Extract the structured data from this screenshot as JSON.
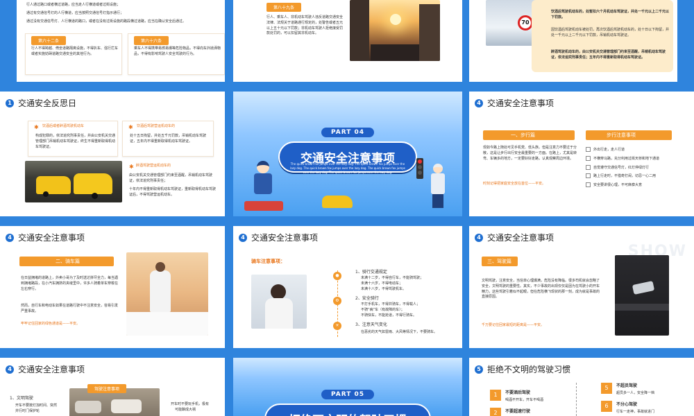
{
  "slides": {
    "s1": {
      "para1": "行人通过路口或者横过道路，应当走人行横道或者过街设施；",
      "para2": "通过有交通信号灯的人行横道，应当按照交通信号灯指示通行；",
      "para3": "通过没有交通信号灯、人行横道的路口，或者在没有过街设施的路段横过道路，应当在确认安全后通过。",
      "card1_title": "第六十二条",
      "card1_text": "行人不得跨越、倚坐道路隔离设施，不得扒车、强行拦车或者实施妨碍道路交通安全的其他行为。",
      "card2_title": "第六十六条",
      "card2_text": "乘车人不得携带易燃易爆等危险物品，不得向车外抛洒物品，不得有影响驾驶人安全驾驶的行为。"
    },
    "s2": {
      "label": "第八十九条",
      "text": "行人、乘车人、非机动车驾驶人违反道路交通安全法律、法规关于道路通行规定的，处警告或者五元以上五十元以下罚款；非机动车驾驶人拒绝接受罚款处罚的，可以扣留其非机动车。"
    },
    "s3": {
      "text1": "饮酒后驾驶机动车的，处暂扣六个月机动车驾驶证，并处一千元以上二千元以下罚款。",
      "text2": "因饮酒后驾驶机动车被处罚，再次饮酒后驾驶机动车的，处十日以下拘留，并处一千元以上二千元以下罚款，吊销机动车驾驶证。",
      "text3": "醉酒驾驶机动车的，由公安机关交通管理部门约束至酒醒，吊销机动车驾驶证，依法追究刑事责任；五年内不得重新取得机动车驾驶证。",
      "sign": "70"
    },
    "s4": {
      "num": "1",
      "title": "交通安全反思日",
      "c1_title": "饮酒后或者醉酒驾驶机动车",
      "c1_text": "构成犯罪的，依法追究刑事责任，并由公安机关交通管理部门吊销机动车驾驶证，终生不得重新取得机动车驾驶证。",
      "c2_title": "饮酒后驾驶营运机动车的",
      "c2_text": "处十五日拘留，并处五千元罚款，吊销机动车驾驶证，五年内不得重新取得机动车驾驶证。",
      "c3_title": "醉酒驾驶营运机动车的",
      "c3_text1": "由公安机关交通管理部门约束至酒醒，吊销机动车驾驶证，依法追究刑事责任；",
      "c3_text2": "十年内不得重新取得机动车驾驶证，重新取得机动车驾驶证后，不得驾驶营运机动车。"
    },
    "s5": {
      "part": "PART 04",
      "title": "交通安全注意事项",
      "engl": "The quick brown fox jumps over the lazy dog. The quick brown fox jumps over the lazy dog. The quick brown fox jumps over the lazy dog. The quick brown fox jumps over the lazy dog. The quick brown fox jumps over the lazy dog."
    },
    "s6": {
      "num": "4",
      "title": "交通安全注意事项",
      "pill1": "一、步行篇",
      "text": "现如今路上随处可见手机党、低头族。但是注意力不要过于分散，这是让步行出行安全最重要的一方面。在路上，尤其是转弯、车辆多的地方，一定要好好走路，认真观察周边环境。",
      "hl": "时刻记得把家庭安全放在首位——平安。",
      "pill2": "步行注意事项",
      "items": [
        "外出行走，走人行道",
        "不横穿马路，充分利用过街天桥和地下通道",
        "自觉遵守交通信号灯，红灯停绿灯行",
        "路上行走时，不猎奇打闹，切忌一心二用",
        "安全要讲很心理，不可麻痹大意"
      ]
    },
    "s7": {
      "num": "4",
      "title": "交通安全注意事项",
      "pill": "二、骑车篇",
      "text": "在日益拥堵的道路上，外卖小哥为了及时送达拼尽全力，每当遇到拥堵路段，在小汽车拥挤的夹缝里中，许多人骑着单车穿梭在左右穿行。",
      "text2": "然而，自行车和电动车如果在道路行驶中不注意安全，容易引发严重事故。",
      "hl": "牢牢记住回家的绿色通道是——平安。"
    },
    "s8": {
      "num": "4",
      "title": "交通安全注意事项",
      "label": "骑车注意事项：",
      "g1_title": "1、骑行交通规定",
      "g1_items": [
        "未满十二岁，不得自行车，不能骑驾驶；",
        "未满十六岁，不得电动车；",
        "未满十八岁，不得驾驶机车。"
      ],
      "g2_title": "2、安全骑行",
      "g2_items": [
        "不打手机车，不得并骑车，不得载人；",
        "不骑“病”车（有故障的车）；",
        "不骑快车，不能抢道，不得行骑车。"
      ],
      "g3_title": "3、注意天气变化",
      "g3_items": [
        "在恶劣的天气如雷雨、大风等情况下，不要骑车。"
      ]
    },
    "s9": {
      "num": "4",
      "title": "交通安全注意事项",
      "pill": "三、驾驶篇",
      "text": "文明驾驶，注意安全，当信单心理爆满，危险没有降临。很多司机就会忽略了安全，文明驾驶的重要性。其实，不少事故的出现仅仅是因为在驾驶小的开车精力，这些驾驶引着似不起眼，但在危险横飞现状的那一刻，成为就是事故的直接原因。",
      "hl": "千万要记住回家最短的距离是——平安。",
      "watermark": "SHOW"
    },
    "s10": {
      "num": "4",
      "title": "交通安全注意事项",
      "l1": "1、文明驾驶",
      "l1b": "开车不要按灯加时间、突然",
      "l1c": "并行时门保护轮",
      "photo_label": "驾驶注意事项",
      "r1": "开车时不要玩手机，极有",
      "r2": "可能酿成大祸"
    },
    "s11": {
      "part": "PART 05",
      "title": "拒绝不文明的驾驶习惯"
    },
    "s12": {
      "num": "5",
      "title": "拒绝不文明的驾驶习惯",
      "i1_n": "1",
      "i1_t": "不要酒后驾驶",
      "i1_s": "喝酒不开车，开车不喝酒",
      "i2_n": "2",
      "i2_t": "不要超速行驶",
      "i5_n": "5",
      "i5_t": "不超员驾驶",
      "i5_s": "超员多一人，安全降一档",
      "i6_n": "6",
      "i6_t": "不分心驾驶",
      "i6_s": "行车一走神，事故就进门"
    }
  }
}
